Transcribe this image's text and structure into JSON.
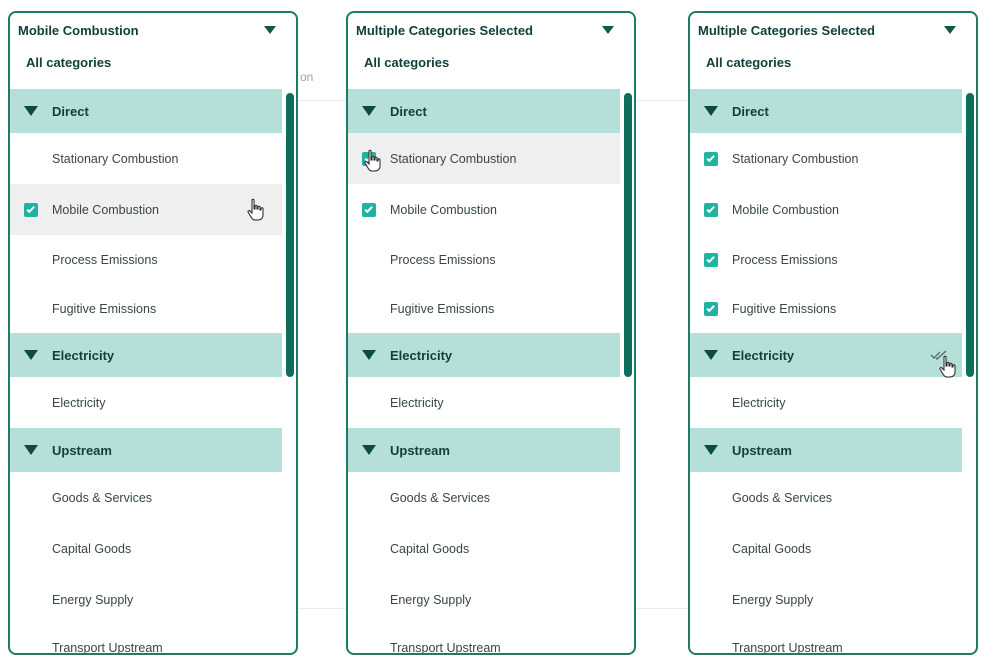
{
  "background": {
    "fragment_text": "on"
  },
  "panels": [
    {
      "header_title": "Mobile Combustion",
      "all_categories": "All categories",
      "groups": {
        "direct": "Direct",
        "electricity": "Electricity",
        "upstream": "Upstream"
      },
      "items": {
        "stationary": "Stationary Combustion",
        "mobile": "Mobile Combustion",
        "process": "Process Emissions",
        "fugitive": "Fugitive Emissions",
        "electricity": "Electricity",
        "goods": "Goods & Services",
        "capital": "Capital Goods",
        "energy": "Energy Supply",
        "transport": "Transport Upstream"
      },
      "checked": {
        "stationary": false,
        "mobile": true,
        "process": false,
        "fugitive": false
      }
    },
    {
      "header_title": "Multiple Categories Selected",
      "all_categories": "All categories",
      "groups": {
        "direct": "Direct",
        "electricity": "Electricity",
        "upstream": "Upstream"
      },
      "items": {
        "stationary": "Stationary Combustion",
        "mobile": "Mobile Combustion",
        "process": "Process Emissions",
        "fugitive": "Fugitive Emissions",
        "electricity": "Electricity",
        "goods": "Goods & Services",
        "capital": "Capital Goods",
        "energy": "Energy Supply",
        "transport": "Transport Upstream"
      },
      "checked": {
        "stationary": true,
        "mobile": true,
        "process": false,
        "fugitive": false
      }
    },
    {
      "header_title": "Multiple Categories Selected",
      "all_categories": "All categories",
      "groups": {
        "direct": "Direct",
        "electricity": "Electricity",
        "upstream": "Upstream"
      },
      "items": {
        "stationary": "Stationary Combustion",
        "mobile": "Mobile Combustion",
        "process": "Process Emissions",
        "fugitive": "Fugitive Emissions",
        "electricity": "Electricity",
        "goods": "Goods & Services",
        "capital": "Capital Goods",
        "energy": "Energy Supply",
        "transport": "Transport Upstream"
      },
      "checked": {
        "stationary": true,
        "mobile": true,
        "process": true,
        "fugitive": true
      }
    }
  ],
  "colors": {
    "accent": "#1fb3a0",
    "border": "#1f7a66",
    "group_bg": "#b4e0d9",
    "scrollbar": "#0d6e5c",
    "hover_bg": "#efefef"
  },
  "icons": [
    "caret-down-icon",
    "checkbox-checked-icon",
    "hand-pointer-icon",
    "double-check-icon"
  ]
}
